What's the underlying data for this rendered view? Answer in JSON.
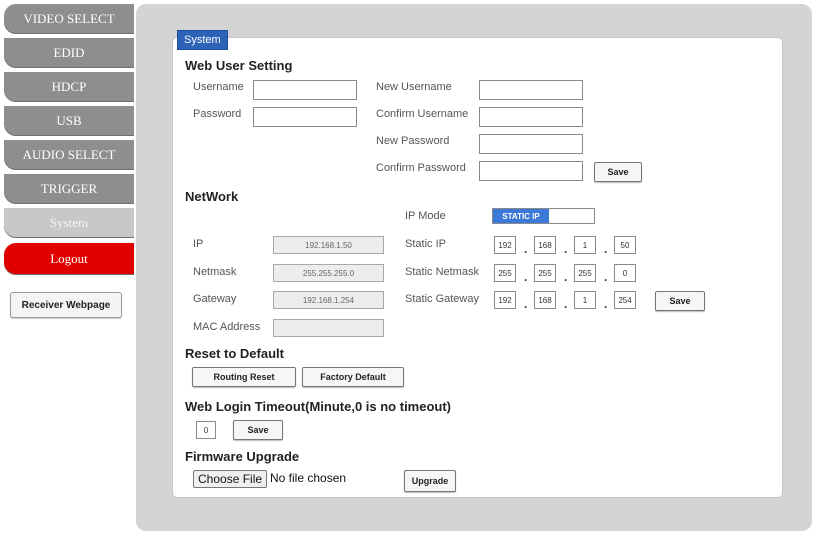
{
  "sidebar": {
    "items": [
      {
        "label": "VIDEO SELECT"
      },
      {
        "label": "EDID"
      },
      {
        "label": "HDCP"
      },
      {
        "label": "USB"
      },
      {
        "label": "AUDIO SELECT"
      },
      {
        "label": "TRIGGER"
      },
      {
        "label": "System"
      }
    ],
    "logout": "Logout",
    "receiver": "Receiver Webpage"
  },
  "tab": "System",
  "web_user": {
    "heading": "Web User Setting",
    "username": "Username",
    "password": "Password",
    "new_username": "New Username",
    "confirm_username": "Confirm Username",
    "new_password": "New Password",
    "confirm_password": "Confirm Password",
    "save": "Save"
  },
  "network": {
    "heading": "NetWork",
    "ip_mode_label": "IP Mode",
    "ip_mode_value": "STATIC IP",
    "ip_label": "IP",
    "ip_value": "192.168.1.50",
    "netmask_label": "Netmask",
    "netmask_value": "255.255.255.0",
    "gateway_label": "Gateway",
    "gateway_value": "192.168.1.254",
    "mac_label": "MAC Address",
    "mac_value": "",
    "static_ip_label": "Static IP",
    "static_ip": [
      "192",
      "168",
      "1",
      "50"
    ],
    "static_netmask_label": "Static Netmask",
    "static_netmask": [
      "255",
      "255",
      "255",
      "0"
    ],
    "static_gateway_label": "Static Gateway",
    "static_gateway": [
      "192",
      "168",
      "1",
      "254"
    ],
    "dot": ".",
    "save": "Save"
  },
  "reset": {
    "heading": "Reset to Default",
    "routing": "Routing Reset",
    "factory": "Factory Default"
  },
  "timeout": {
    "heading": "Web Login Timeout(Minute,0 is no timeout)",
    "value": "0",
    "save": "Save"
  },
  "firmware": {
    "heading": "Firmware Upgrade",
    "choose": "Choose File",
    "no_file": "No file chosen",
    "upgrade": "Upgrade"
  },
  "colors": {
    "accent": "#2c63b8",
    "ip_mode_fill": "#3b78d8",
    "nav": "#8e8e8e",
    "nav_active": "#c8c8c8",
    "logout": "#e00000"
  }
}
